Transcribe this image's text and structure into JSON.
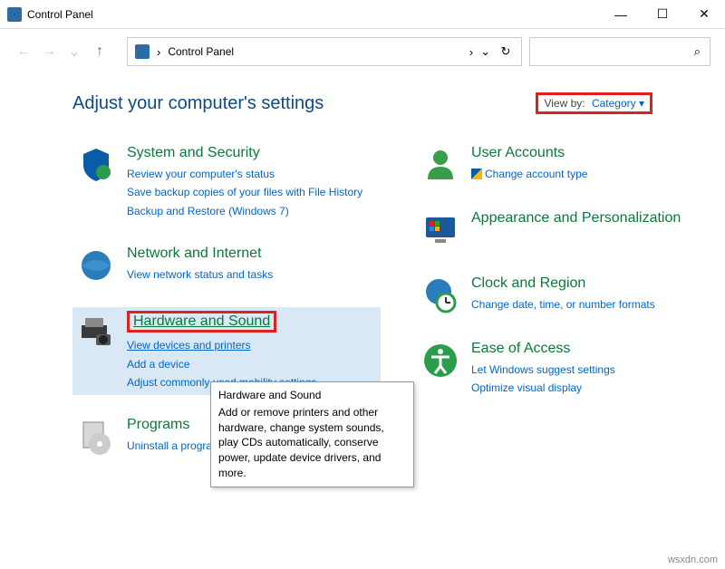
{
  "window": {
    "title": "Control Panel"
  },
  "address": {
    "path": "Control Panel",
    "chevron": "›"
  },
  "page": {
    "heading": "Adjust your computer's settings"
  },
  "viewby": {
    "label": "View by:",
    "value": "Category ▾"
  },
  "left": [
    {
      "title": "System and Security",
      "links": [
        "Review your computer's status",
        "Save backup copies of your files with File History",
        "Backup and Restore (Windows 7)"
      ]
    },
    {
      "title": "Network and Internet",
      "links": [
        "View network status and tasks"
      ]
    },
    {
      "title": "Hardware and Sound",
      "links": [
        "View devices and printers",
        "Add a device",
        "Adjust commonly used mobility settings"
      ],
      "boxed": true,
      "highlight": true
    },
    {
      "title": "Programs",
      "links": [
        "Uninstall a program"
      ]
    }
  ],
  "right": [
    {
      "title": "User Accounts",
      "links": [
        "Change account type"
      ],
      "shield": true
    },
    {
      "title": "Appearance and Personalization",
      "links": []
    },
    {
      "title": "Clock and Region",
      "links": [
        "Change date, time, or number formats"
      ]
    },
    {
      "title": "Ease of Access",
      "links": [
        "Let Windows suggest settings",
        "Optimize visual display"
      ]
    }
  ],
  "tooltip": {
    "title": "Hardware and Sound",
    "body": "Add or remove printers and other hardware, change system sounds, play CDs automatically, conserve power, update device drivers, and more."
  },
  "watermark": "wsxdn.com"
}
